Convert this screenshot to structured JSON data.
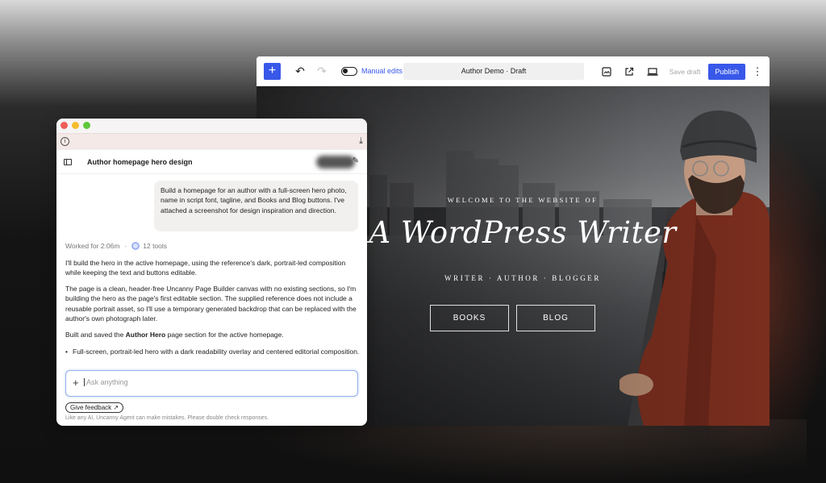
{
  "editor": {
    "toolbar": {
      "add_icon": "plus-icon",
      "undo_icon": "undo-icon",
      "redo_icon": "redo-icon",
      "manual_edits_label": "Manual edits",
      "document_title": "Author Demo · Draft",
      "save_draft_label": "Save draft",
      "publish_label": "Publish",
      "accent_color": "#3858e9"
    },
    "hero": {
      "welcome": "WELCOME TO THE WEBSITE OF",
      "name": "A WordPress Writer",
      "tagline": "WRITER · AUTHOR · BLOGGER",
      "buttons": [
        "BOOKS",
        "BLOG"
      ]
    }
  },
  "chat": {
    "title": "Author homepage hero design",
    "user_message": "Build a homepage for an author with a full-screen hero photo, name in script font, tagline, and Books and Blog buttons. I've attached a screenshot for design inspiration and direction.",
    "worked_for": "Worked for 2:06m",
    "tools": "12 tools",
    "reply": {
      "p1": "I'll build the hero in the active homepage, using the reference's dark, portrait-led composition while keeping the text and buttons editable.",
      "p2": "The page is a clean, header-free Uncanny Page Builder canvas with no existing sections, so I'm building the hero as the page's first editable section. The supplied reference does not include a reusable portrait asset, so I'll use a temporary generated backdrop that can be replaced with the author's own photograph later.",
      "p3_prefix": "Built and saved the ",
      "p3_bold": "Author Hero",
      "p3_suffix": " page section for the active homepage.",
      "bullet": "Full-screen, portrait-led hero with a dark readability overlay and centered editorial composition."
    },
    "input_placeholder": "Ask anything",
    "feedback_label": "Give feedback",
    "disclaimer": "Like any AI, Uncanny Agent can make mistakes. Please double check responses."
  }
}
